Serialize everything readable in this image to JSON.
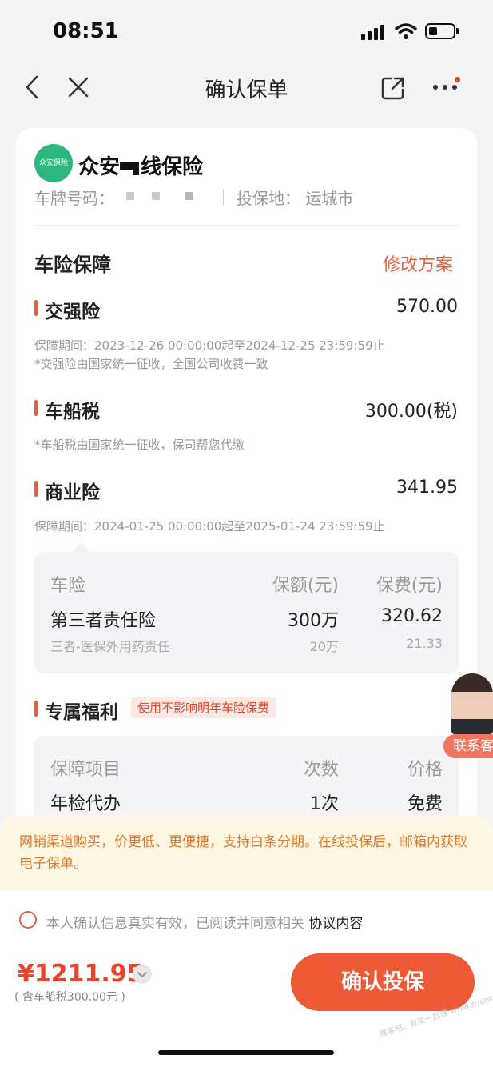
{
  "status_bar": {
    "time": "08:51"
  },
  "nav": {
    "title": "确认保单"
  },
  "header": {
    "logo_text": "众安保险",
    "company_name": "众安",
    "company_name_tail": "线保险",
    "plate_label": "车牌号码：",
    "location_label": "投保地：",
    "location_value": "运城市"
  },
  "coverage": {
    "title": "车险保障",
    "edit_link": "修改方案"
  },
  "items": [
    {
      "name": "交强险",
      "price": "570.00",
      "notes": [
        "保障期间：2023-12-26 00:00:00起至2024-12-25 23:59:59止",
        "*交强险由国家统一征收，全国公司收费一致"
      ]
    },
    {
      "name": "车船税",
      "price": "300.00(税)",
      "notes": [
        "*车船税由国家统一征收，保司帮您代缴"
      ]
    },
    {
      "name": "商业险",
      "price": "341.95",
      "notes": [
        "保障期间：2024-01-25 00:00:00起至2025-01-24 23:59:59止"
      ]
    }
  ],
  "commercial_table": {
    "headers": [
      "车险",
      "保额(元)",
      "保费(元)"
    ],
    "rows": [
      {
        "name": "第三者责任险",
        "amount": "300万",
        "premium": "320.62"
      },
      {
        "name": "三者-医保外用药责任",
        "amount": "20万",
        "premium": "21.33"
      }
    ]
  },
  "benefits": {
    "title": "专属福利",
    "tag": "使用不影响明年车险保费",
    "headers": [
      "保障项目",
      "次数",
      "价格"
    ],
    "rows": [
      {
        "name": "年检代办",
        "count": "1次",
        "price": "免费"
      }
    ]
  },
  "service": {
    "label": "联系客服"
  },
  "notice": {
    "text": "网销渠道购买，价更低、更便捷，支持白条分期。在线投保后，邮箱内获取电子保单。"
  },
  "footer": {
    "agree_text": "本人确认信息真实有效，已阅读并同意相关",
    "agree_link": "协议内容",
    "total": "¥1211.95",
    "tax_note": "( 含车船税300.00元 )",
    "confirm": "确认投保",
    "watermark": "赚客吧，有奖一起赚 www.zuanke8.com"
  },
  "colors": {
    "accent": "#e8603a",
    "brand_green": "#2bb77d",
    "notice_bg": "#fdf7e3"
  }
}
